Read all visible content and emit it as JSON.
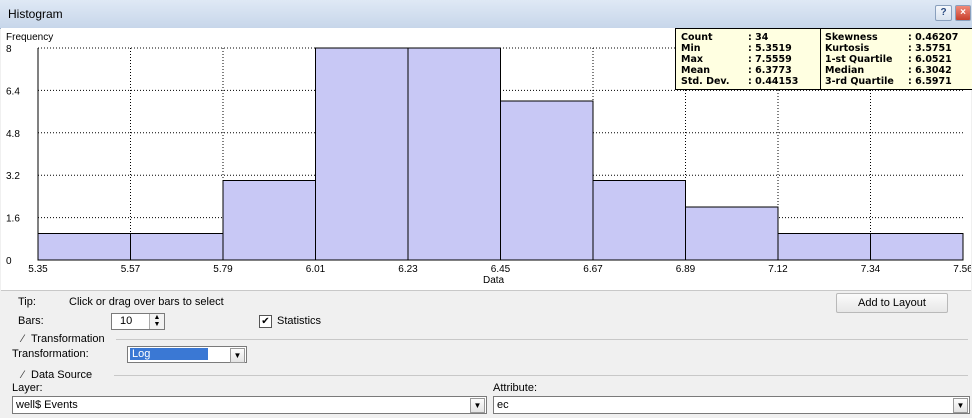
{
  "window": {
    "title": "Histogram",
    "help_label": "?",
    "close_label": "×"
  },
  "stats": {
    "left": [
      {
        "label": "Count",
        "value": ": 34"
      },
      {
        "label": "Min",
        "value": ": 5.3519"
      },
      {
        "label": "Max",
        "value": ": 7.5559"
      },
      {
        "label": "Mean",
        "value": ": 6.3773"
      },
      {
        "label": "Std. Dev.",
        "value": ": 0.44153"
      }
    ],
    "right": [
      {
        "label": "Skewness",
        "value": ": 0.46207"
      },
      {
        "label": "Kurtosis",
        "value": ": 3.5751"
      },
      {
        "label": "1-st Quartile",
        "value": ": 6.0521"
      },
      {
        "label": "Median",
        "value": ": 6.3042"
      },
      {
        "label": "3-rd Quartile",
        "value": ": 6.5971"
      }
    ]
  },
  "chart_data": {
    "type": "bar",
    "xlabel": "Data",
    "ylabel": "Frequency",
    "x_ticks": [
      "5.35",
      "5.57",
      "5.79",
      "6.01",
      "6.23",
      "6.45",
      "6.67",
      "6.89",
      "7.12",
      "7.34",
      "7.56"
    ],
    "y_ticks": [
      "0",
      "1.6",
      "3.2",
      "4.8",
      "6.4",
      "8"
    ],
    "ylim": [
      0,
      8
    ],
    "values": [
      1,
      1,
      3,
      8,
      8,
      6,
      3,
      2,
      1,
      1
    ],
    "grid": true
  },
  "controls": {
    "tip_label": "Tip:",
    "tip_text": "Click or drag over bars to select",
    "add_layout": "Add to Layout",
    "bars_label": "Bars:",
    "bars_value": "10",
    "statistics_label": "Statistics",
    "statistics_checked": "✔",
    "transformation_group": "Transformation",
    "transformation_label": "Transformation:",
    "transformation_value": "Log",
    "data_source_group": "Data Source",
    "layer_label": "Layer:",
    "layer_value": "well$ Events",
    "attribute_label": "Attribute:",
    "attribute_value": "ec"
  }
}
